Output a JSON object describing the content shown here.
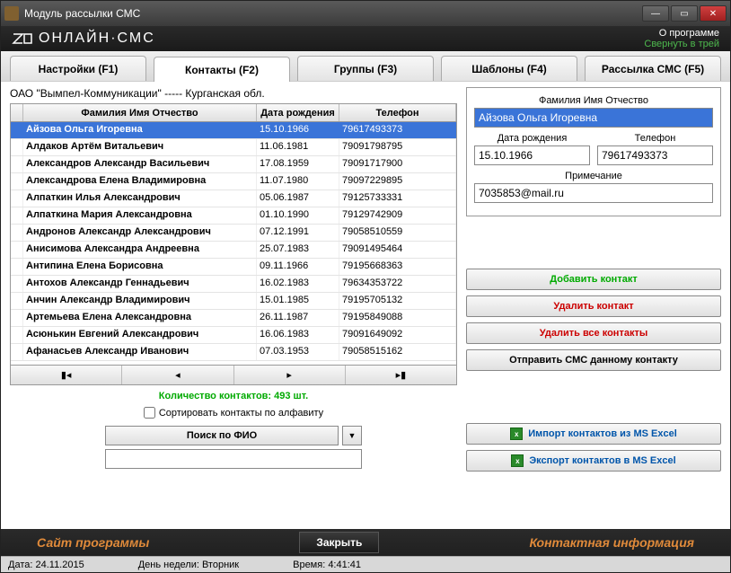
{
  "window": {
    "title": "Модуль рассылки СМС"
  },
  "header": {
    "logo": "ОНЛАЙН·СМС",
    "about": "О программе",
    "minimize": "Свернуть в трей"
  },
  "tabs": [
    {
      "label": "Настройки (F1)"
    },
    {
      "label": "Контакты (F2)"
    },
    {
      "label": "Группы (F3)"
    },
    {
      "label": "Шаблоны (F4)"
    },
    {
      "label": "Рассылка СМС (F5)"
    }
  ],
  "breadcrumb": "ОАО \"Вымпел-Коммуникации\" ----- Курганская обл.",
  "columns": {
    "name": "Фамилия Имя Отчество",
    "dob": "Дата рождения",
    "phone": "Телефон"
  },
  "rows": [
    {
      "name": "Айзова Ольга Игоревна",
      "dob": "15.10.1966",
      "phone": "79617493373"
    },
    {
      "name": "Алдаков Артём Витальевич",
      "dob": "11.06.1981",
      "phone": "79091798795"
    },
    {
      "name": "Александров Александр Васильевич",
      "dob": "17.08.1959",
      "phone": "79091717900"
    },
    {
      "name": "Александрова Елена Владимировна",
      "dob": "11.07.1980",
      "phone": "79097229895"
    },
    {
      "name": "Алпаткин Илья Александрович",
      "dob": "05.06.1987",
      "phone": "79125733331"
    },
    {
      "name": "Алпаткина Мария Александровна",
      "dob": "01.10.1990",
      "phone": "79129742909"
    },
    {
      "name": "Андронов Александр Александрович",
      "dob": "07.12.1991",
      "phone": "79058510559"
    },
    {
      "name": "Анисимова Александра Андреевна",
      "dob": "25.07.1983",
      "phone": "79091495464"
    },
    {
      "name": "Антипина Елена Борисовна",
      "dob": "09.11.1966",
      "phone": "79195668363"
    },
    {
      "name": "Антохов Александр Геннадьевич",
      "dob": "16.02.1983",
      "phone": "79634353722"
    },
    {
      "name": "Анчин Александр Владимирович",
      "dob": "15.01.1985",
      "phone": "79195705132"
    },
    {
      "name": "Артемьева Елена Александровна",
      "dob": "26.11.1987",
      "phone": "79195849088"
    },
    {
      "name": "Асюнькин Евгений Александрович",
      "dob": "16.06.1983",
      "phone": "79091649092"
    },
    {
      "name": "Афанасьев Александр Иванович",
      "dob": "07.03.1953",
      "phone": "79058515162"
    }
  ],
  "nav": {
    "first": "▮◂",
    "prev": "◂",
    "next": "▸",
    "last": "▸▮"
  },
  "count": "Количество контактов: 493 шт.",
  "sortlabel": "Сортировать контакты по алфавиту",
  "searchbtn": "Поиск по ФИО",
  "detail": {
    "name_label": "Фамилия Имя Отчество",
    "name": "Айзова Ольга Игоревна",
    "dob_label": "Дата рождения",
    "dob": "15.10.1966",
    "phone_label": "Телефон",
    "phone": "79617493373",
    "note_label": "Примечание",
    "note": "7035853@mail.ru"
  },
  "actions": {
    "add": "Добавить контакт",
    "delete": "Удалить контакт",
    "delete_all": "Удалить все контакты",
    "send_sms": "Отправить СМС данному контакту",
    "import": "Импорт контактов из MS Excel",
    "export": "Экспорт контактов в MS Excel"
  },
  "footer": {
    "site": "Сайт программы",
    "close": "Закрыть",
    "contact": "Контактная информация"
  },
  "status": {
    "date": "Дата: 24.11.2015",
    "weekday": "День недели: Вторник",
    "time": "Время: 4:41:41"
  }
}
